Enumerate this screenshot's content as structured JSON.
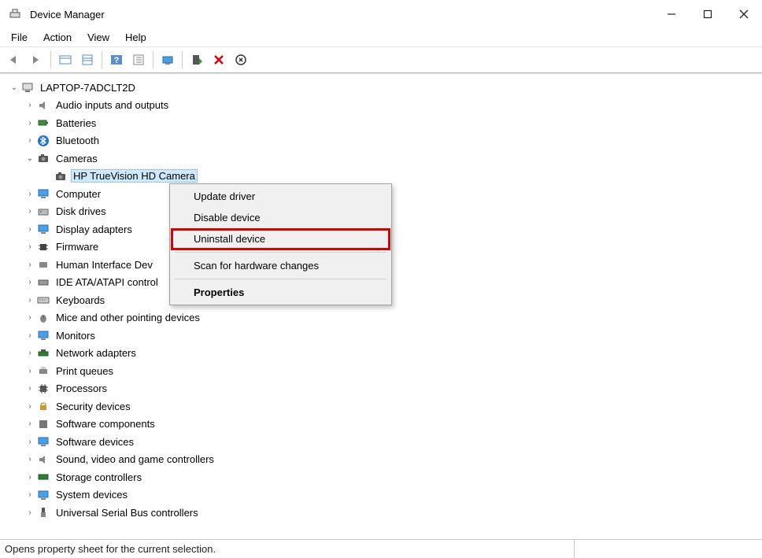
{
  "window": {
    "title": "Device Manager"
  },
  "menu": {
    "file": "File",
    "action": "Action",
    "view": "View",
    "help": "Help"
  },
  "tree": {
    "root": "LAPTOP-7ADCLT2D",
    "audio": "Audio inputs and outputs",
    "batteries": "Batteries",
    "bluetooth": "Bluetooth",
    "cameras": "Cameras",
    "camera_device": "HP TrueVision HD Camera",
    "computer": "Computer",
    "disk_drives": "Disk drives",
    "display_adapters": "Display adapters",
    "firmware": "Firmware",
    "hid": "Human Interface Dev",
    "ide": "IDE ATA/ATAPI control",
    "keyboards": "Keyboards",
    "mice": "Mice and other pointing devices",
    "monitors": "Monitors",
    "network": "Network adapters",
    "print_queues": "Print queues",
    "processors": "Processors",
    "security": "Security devices",
    "soft_components": "Software components",
    "soft_devices": "Software devices",
    "sound": "Sound, video and game controllers",
    "storage": "Storage controllers",
    "system": "System devices",
    "usb": "Universal Serial Bus controllers"
  },
  "context_menu": {
    "update_driver": "Update driver",
    "disable_device": "Disable device",
    "uninstall_device": "Uninstall device",
    "scan": "Scan for hardware changes",
    "properties": "Properties"
  },
  "statusbar": {
    "text": "Opens property sheet for the current selection."
  }
}
